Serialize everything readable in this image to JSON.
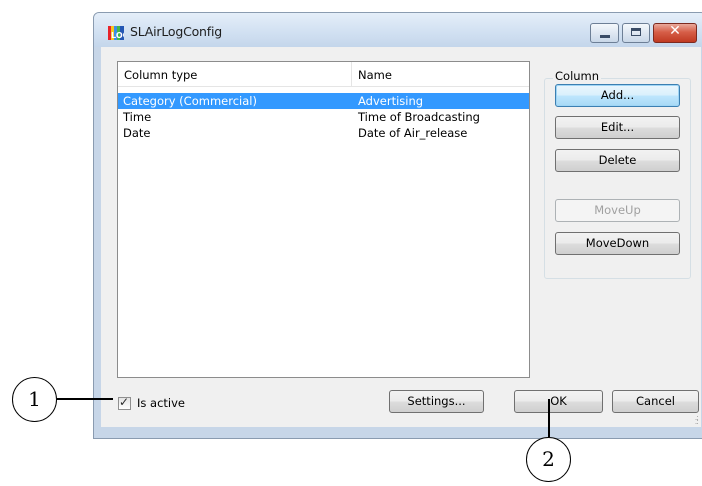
{
  "window": {
    "title": "SLAirLogConfig"
  },
  "list": {
    "columns": [
      "Column type",
      "Name"
    ],
    "rows": [
      {
        "type": "Category (Commercial)",
        "name": "Advertising",
        "selected": true
      },
      {
        "type": "Time",
        "name": "Time of Broadcasting",
        "selected": false
      },
      {
        "type": "Date",
        "name": "Date of Air_release",
        "selected": false
      }
    ]
  },
  "column_group": {
    "label": "Column",
    "add": "Add...",
    "edit": "Edit...",
    "delete": "Delete",
    "move_up": "MoveUp",
    "move_down": "MoveDown"
  },
  "footer": {
    "is_active_label": "Is active",
    "is_active_checked": true,
    "settings": "Settings...",
    "ok": "OK",
    "cancel": "Cancel"
  },
  "callouts": [
    "1",
    "2"
  ],
  "colors": {
    "selection": "#3399ff",
    "close_button": "#c03a22"
  },
  "icons": [
    "app-icon",
    "minimize-icon",
    "maximize-icon",
    "close-icon",
    "checkmark-icon"
  ]
}
